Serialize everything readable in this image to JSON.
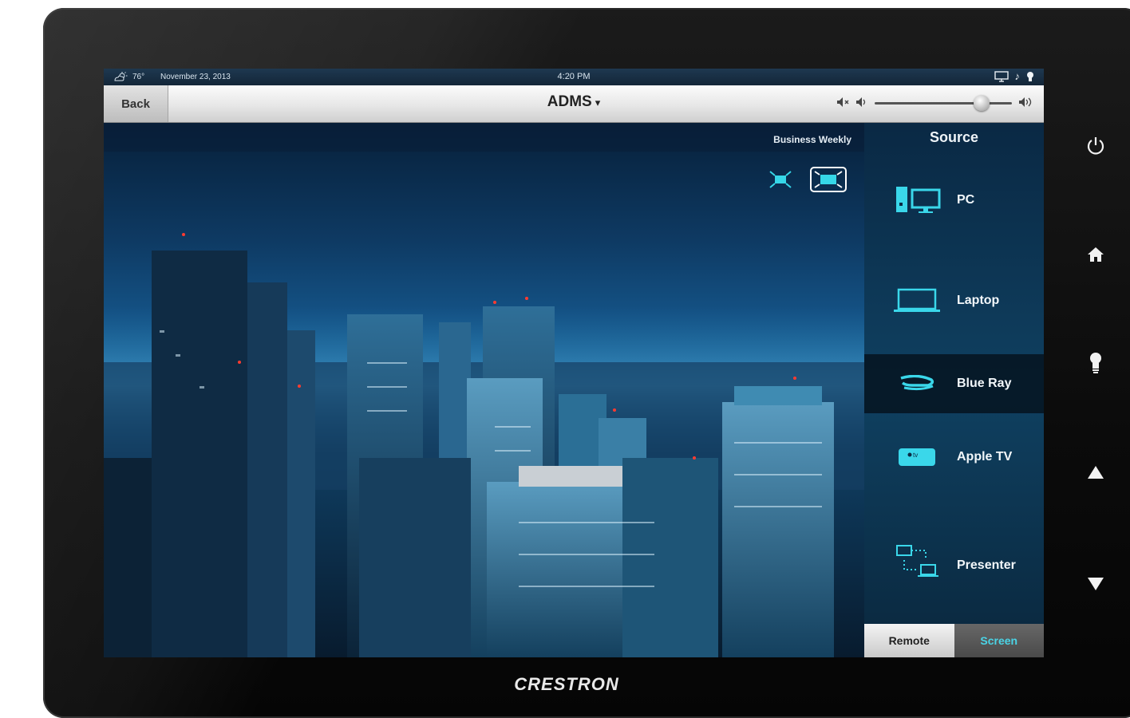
{
  "status_bar": {
    "temperature": "76°",
    "date": "November 23, 2013",
    "time": "4:20 PM",
    "weather_icon": "partly-cloudy-icon",
    "status_icons": [
      "display-icon",
      "music-note-icon",
      "lightbulb-icon"
    ]
  },
  "nav": {
    "back_label": "Back",
    "room_title": "ADMS",
    "room_caret": "▾",
    "volume_level": 0.78
  },
  "content": {
    "channel_label": "Business Weekly",
    "view_icons": [
      "fit-screen-icon",
      "fill-screen-icon"
    ]
  },
  "source_panel": {
    "title": "Source",
    "items": [
      {
        "label": "PC",
        "icon": "pc-icon",
        "active": false
      },
      {
        "label": "Laptop",
        "icon": "laptop-icon",
        "active": false
      },
      {
        "label": "Blue Ray",
        "icon": "bluray-icon",
        "active": true
      },
      {
        "label": "Apple TV",
        "icon": "apple-tv-icon",
        "active": false
      },
      {
        "label": "Presenter",
        "icon": "presenter-icon",
        "active": false
      }
    ],
    "apple_tv_badge": "tv",
    "tabs": {
      "remote": "Remote",
      "screen": "Screen"
    }
  },
  "hard_buttons": [
    "power-icon",
    "home-icon",
    "lightbulb-icon",
    "up-arrow-icon",
    "down-arrow-icon"
  ],
  "brand": "CRESTRON",
  "colors": {
    "accent": "#4ad4e6",
    "nav_bg": "#e8e8e8",
    "panel_bg": "#0e3a5a"
  }
}
